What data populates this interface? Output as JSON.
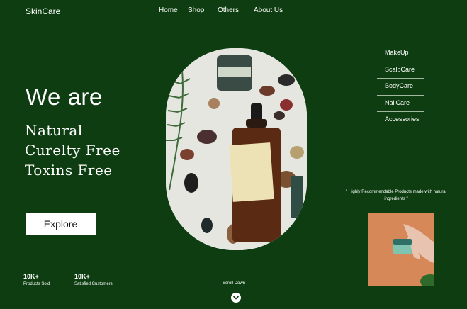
{
  "brand": "SkinCare",
  "nav": {
    "home": "Home",
    "shop": "Shop",
    "others": "Others",
    "about": "About Us"
  },
  "hero": {
    "headline": "We are",
    "lines": [
      "Natural",
      "Curelty Free",
      "Toxins Free"
    ],
    "cta": "Explore"
  },
  "stats": [
    {
      "value": "10K+",
      "label": "Products Sold"
    },
    {
      "value": "10K+",
      "label": "Satisfied Customers"
    }
  ],
  "scroll_label": "Scroll Down",
  "categories": [
    "MakeUp",
    "ScalpCare",
    "BodyCare",
    "NailCare",
    "Accessories"
  ],
  "recommendation": "\" Highly Recommendable Products made with natural ingredients \"",
  "colors": {
    "background": "#0d3d10",
    "button": "#ffffff"
  }
}
